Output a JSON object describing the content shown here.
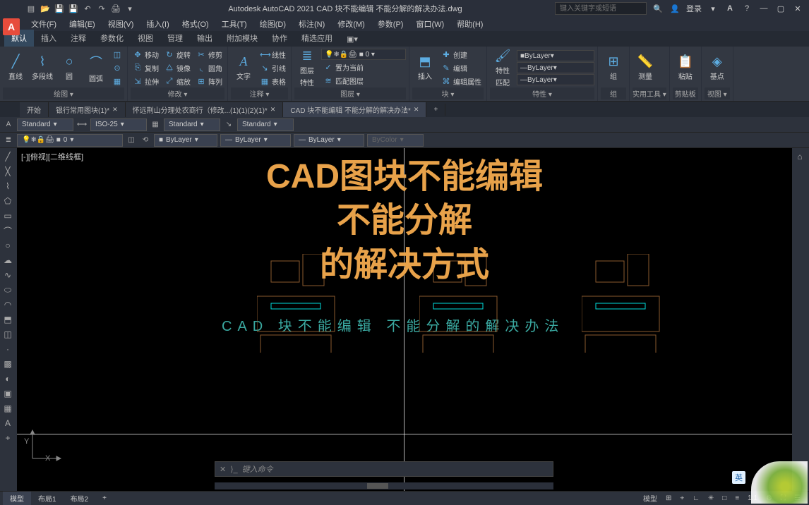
{
  "app": {
    "logo": "A",
    "title": "Autodesk AutoCAD 2021   CAD 块不能编辑 不能分解的解决办法.dwg",
    "search_placeholder": "键入关键字或短语",
    "login": "登录"
  },
  "menus": [
    "文件(F)",
    "编辑(E)",
    "视图(V)",
    "插入(I)",
    "格式(O)",
    "工具(T)",
    "绘图(D)",
    "标注(N)",
    "修改(M)",
    "参数(P)",
    "窗口(W)",
    "帮助(H)"
  ],
  "ribbon_tabs": [
    "默认",
    "插入",
    "注释",
    "参数化",
    "视图",
    "管理",
    "输出",
    "附加模块",
    "协作",
    "精选应用"
  ],
  "ribbon": {
    "panel1": {
      "title": "绘图 ▾",
      "b1": "直线",
      "b2": "多段线",
      "b3": "圆",
      "b4": "圆弧"
    },
    "panel2": {
      "title": "修改 ▾",
      "r1": "移动",
      "r2": "复制",
      "r3": "拉伸",
      "c1": "旋转",
      "c2": "镜像",
      "c3": "缩放",
      "d1": "修剪",
      "d2": "圆角",
      "d3": "阵列"
    },
    "panel3": {
      "title": "注释 ▾",
      "b1": "文字",
      "r1": "线性",
      "r2": "引线",
      "r3": "表格"
    },
    "panel4": {
      "title": "图层 ▾",
      "b1": "图层",
      "b2": "特性",
      "r1": "置为当前",
      "r2": "匹配图层"
    },
    "panel5": {
      "title": "块 ▾",
      "b1": "插入",
      "r1": "创建",
      "r2": "编辑",
      "r3": "编辑属性"
    },
    "panel6": {
      "title": "特性 ▾",
      "b1": "特性",
      "b2": "匹配",
      "c1": "ByLayer",
      "c2": "ByLayer",
      "c3": "ByLayer"
    },
    "panel7": {
      "title": "组",
      "b1": "组"
    },
    "panel8": {
      "title": "实用工具 ▾",
      "b1": "测量"
    },
    "panel9": {
      "title": "剪贴板",
      "b1": "粘贴"
    },
    "panel10": {
      "title": "视图 ▾",
      "b1": "基点"
    }
  },
  "doc_tabs": [
    {
      "label": "开始"
    },
    {
      "label": "银行常用图块(1)*"
    },
    {
      "label": "怀远荆山分理处农商行（修改...(1)(1)(2)(1)*"
    },
    {
      "label": "CAD 块不能编辑 不能分解的解决办法*",
      "active": true
    }
  ],
  "style_row": {
    "s1": "Standard",
    "s2": "ISO-25",
    "s3": "Standard",
    "s4": "Standard"
  },
  "layer_row": {
    "current": "0",
    "c1": "ByLayer",
    "c2": "ByLayer",
    "c3": "ByLayer",
    "c4": "ByColor"
  },
  "view_label": "[-][俯视][二维线框]",
  "overlay": {
    "l1": "CAD图块不能编辑",
    "l2": "不能分解",
    "l3": "的解决方式"
  },
  "cyan_text": "CAD 块不能编辑 不能分解的解决办法",
  "ucs": {
    "x": "X",
    "y": "Y"
  },
  "cmd": {
    "prompt": "键入命令"
  },
  "model_tabs": [
    "模型",
    "布局1",
    "布局2"
  ],
  "status": {
    "model": "模型",
    "scale": "1:1"
  },
  "ime": "英"
}
